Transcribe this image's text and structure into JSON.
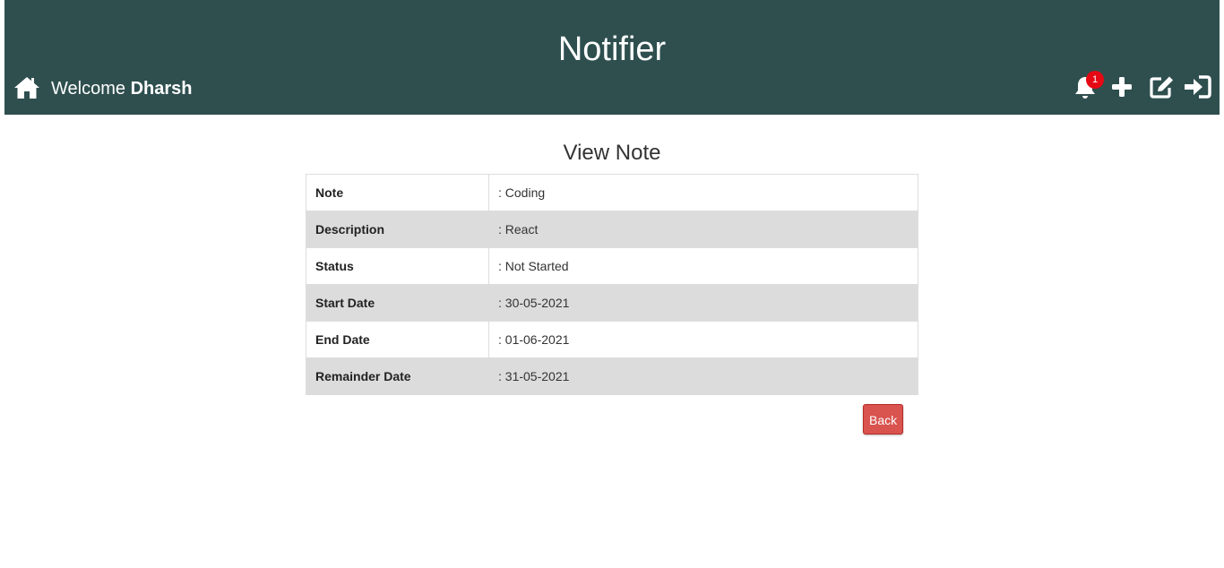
{
  "header": {
    "app_title": "Notifier",
    "welcome_prefix": "Welcome",
    "user_name": "Dharsh",
    "notification_count": "1",
    "background_color": "#2f4f4f",
    "icons": [
      "home-icon",
      "bell-icon",
      "plus-icon",
      "edit-icon",
      "sign-in-icon"
    ]
  },
  "main": {
    "title": "View Note",
    "rows": [
      {
        "label": "Note",
        "value": ": Coding"
      },
      {
        "label": "Description",
        "value": ": React"
      },
      {
        "label": "Status",
        "value": ": Not Started"
      },
      {
        "label": "Start Date",
        "value": ": 30-05-2021"
      },
      {
        "label": "End Date",
        "value": ": 01-06-2021"
      },
      {
        "label": "Remainder Date",
        "value": ": 31-05-2021"
      }
    ],
    "back_label": "Back",
    "back_color": "#d9534f"
  }
}
